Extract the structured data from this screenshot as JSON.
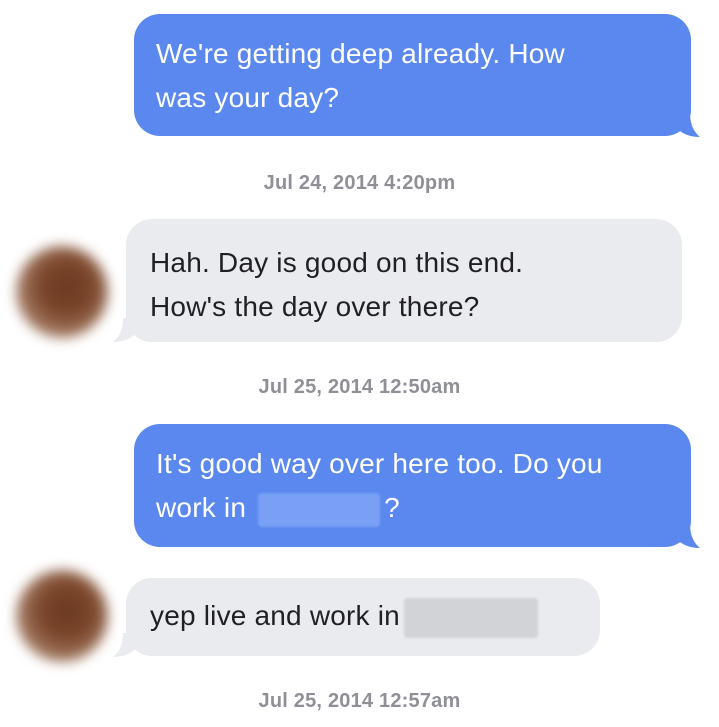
{
  "messages": [
    {
      "direction": "sent",
      "lines": [
        "We're getting deep already. How",
        "was your day?"
      ]
    },
    {
      "timestamp": "Jul 24, 2014 4:20pm"
    },
    {
      "direction": "received",
      "lines": [
        "Hah. Day is good on this end.",
        "How's the day over there?"
      ]
    },
    {
      "timestamp": "Jul 25, 2014 12:50am"
    },
    {
      "direction": "sent",
      "lines": [
        "It's good way over here too. Do you",
        "work in",
        "?"
      ]
    },
    {
      "direction": "received",
      "lines": [
        "yep live and work in"
      ]
    },
    {
      "timestamp": "Jul 25, 2014 12:57am"
    }
  ],
  "colors": {
    "sent_bubble": "#5a88ee",
    "received_bubble": "#eaebee",
    "timestamp_text": "#8f9097"
  },
  "redactions": [
    "blurred-location",
    "blurred-location"
  ]
}
